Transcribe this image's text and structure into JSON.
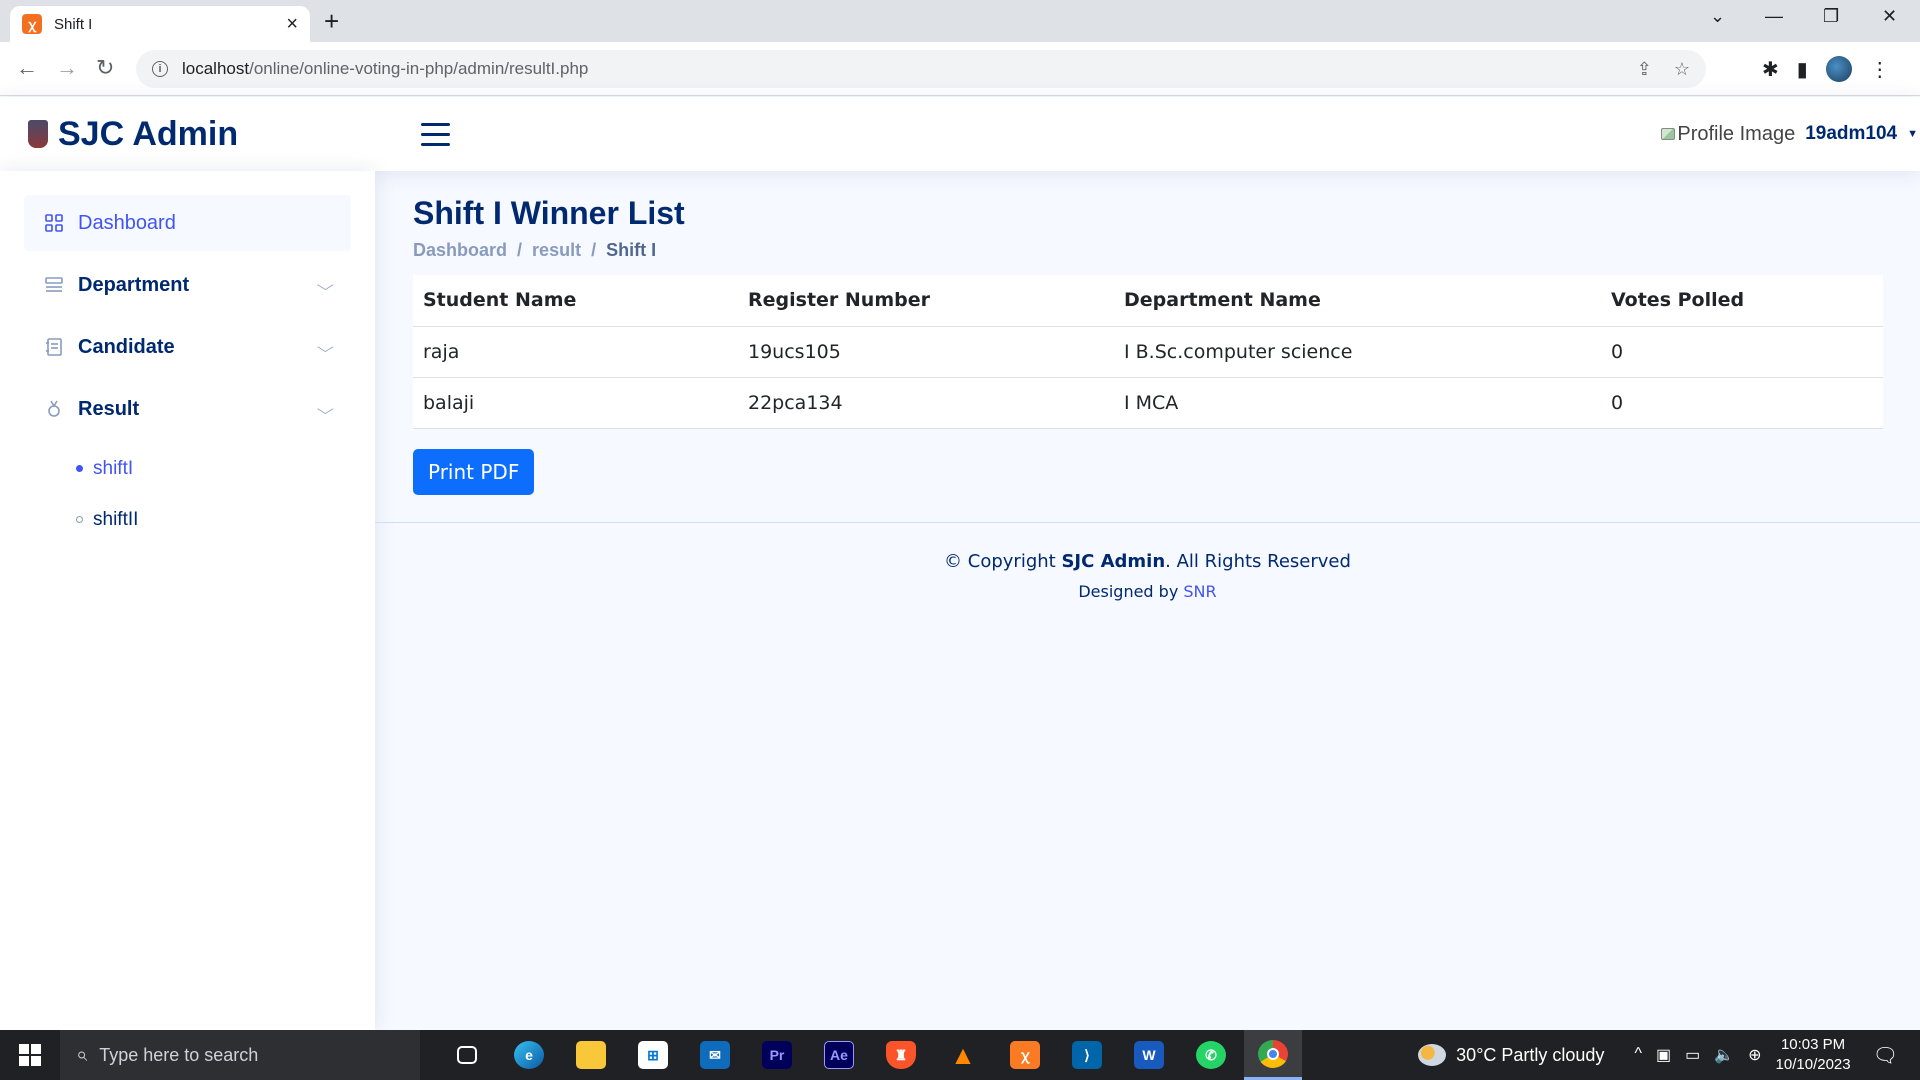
{
  "browser": {
    "tab_title": "Shift I",
    "url_host": "localhost",
    "url_path": "/online/online-voting-in-php/admin/resultI.php"
  },
  "header": {
    "brand": "SJC Admin",
    "profile_image_alt": "Profile Image",
    "username": "19adm104"
  },
  "sidebar": {
    "items": [
      {
        "label": "Dashboard",
        "icon": "grid-icon"
      },
      {
        "label": "Department",
        "icon": "menu-button-icon"
      },
      {
        "label": "Candidate",
        "icon": "journal-icon"
      },
      {
        "label": "Result",
        "icon": "award-icon"
      }
    ],
    "result_sub": [
      {
        "label": "shiftI"
      },
      {
        "label": "shiftII"
      }
    ]
  },
  "main": {
    "title": "Shift I Winner List",
    "breadcrumb": [
      "Dashboard",
      "result",
      "Shift I"
    ],
    "table": {
      "headers": [
        "Student Name",
        "Register Number",
        "Department Name",
        "Votes Polled"
      ],
      "rows": [
        [
          "raja",
          "19ucs105",
          "I B.Sc.computer science",
          "0"
        ],
        [
          "balaji",
          "22pca134",
          "I MCA",
          "0"
        ]
      ]
    },
    "print_button": "Print PDF"
  },
  "footer": {
    "copyright_prefix": "© Copyright",
    "copyright_brand": "SJC Admin",
    "copyright_suffix": ". All Rights Reserved",
    "designed_by": "Designed by",
    "designer": "SNR"
  },
  "taskbar": {
    "search_placeholder": "Type here to search",
    "weather": "30°C  Partly cloudy",
    "time": "10:03 PM",
    "date": "10/10/2023"
  },
  "colors": {
    "brand": "#012970",
    "accent": "#4154f1",
    "button": "#0d6efd"
  }
}
